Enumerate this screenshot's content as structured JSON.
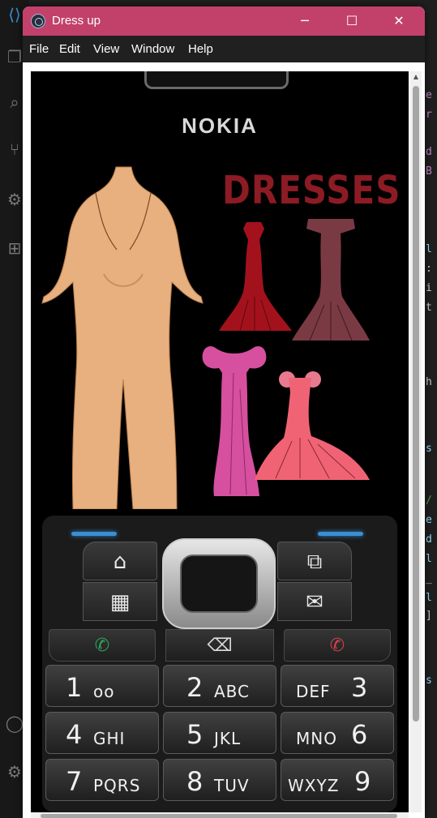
{
  "window": {
    "title": "Dress up",
    "controls": {
      "minimize": "─",
      "maximize": "☐",
      "close": "✕"
    }
  },
  "menu": [
    "File",
    "Edit",
    "View",
    "Window",
    "Help"
  ],
  "phone": {
    "brand": "NOKIA",
    "heading": "DRESSES",
    "keys": {
      "home": "⌂",
      "shortcut": "⧉",
      "calendar": "▦",
      "message": "✉",
      "call": "✆",
      "end": "✆",
      "clear": "⌫"
    },
    "number_keys": [
      {
        "digit": "1",
        "letters": "oo"
      },
      {
        "digit": "2",
        "letters": "ABC"
      },
      {
        "digit": "3",
        "letters": "DEF"
      },
      {
        "digit": "4",
        "letters": "GHI"
      },
      {
        "digit": "5",
        "letters": "JKL"
      },
      {
        "digit": "6",
        "letters": "MNO"
      },
      {
        "digit": "7",
        "letters": "PQRS"
      },
      {
        "digit": "8",
        "letters": "TUV"
      },
      {
        "digit": "9",
        "letters": "WXYZ"
      }
    ]
  },
  "colors": {
    "titlebar": "#c2416a",
    "menubar": "#202020",
    "dress_red": "#a3121c",
    "dress_mauve": "#7a3a44",
    "dress_pink": "#d6509f",
    "dress_coral": "#f06375",
    "body_skin": "#e8b07f",
    "led_blue": "#3a8fd0"
  }
}
